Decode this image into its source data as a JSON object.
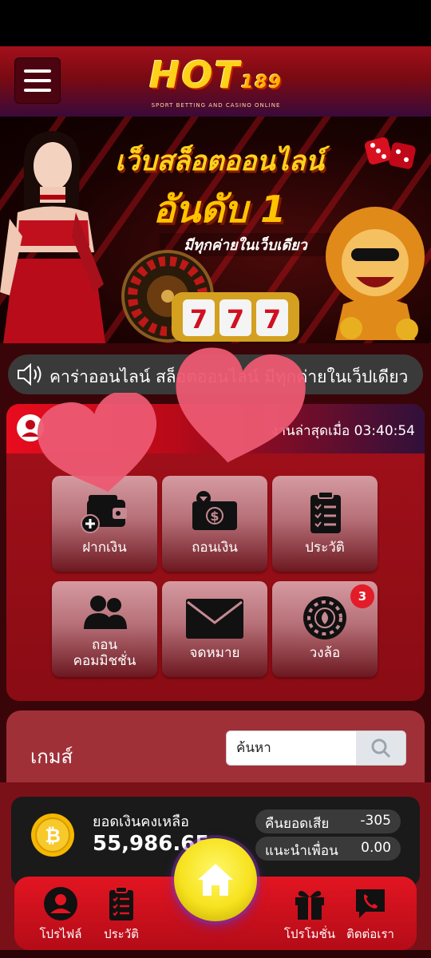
{
  "header": {
    "logo_text": "HOT",
    "logo_number": "189",
    "logo_tagline": "SPORT BETTING AND CASINO ONLINE"
  },
  "banner": {
    "title_line1": "เว็บสล็อตออนไลน์",
    "title_line2": "อันดับ 1",
    "subtitle": "มีทุกค่ายในเว็บเดียว"
  },
  "ticker": {
    "text": "คาร่าออนไลน์ สล็อตออนไลน์ มีทุกค่ายในเว็ปเดียว"
  },
  "user": {
    "last_login_label": "ออนไลน์ล่าสุดเมื่อ",
    "last_login_visible": "งานล่าสุดเมื่อ",
    "last_login_time": "03:40:54"
  },
  "tiles": [
    {
      "label": "ฝากเงิน",
      "icon": "wallet-plus-icon"
    },
    {
      "label": "ถอนเงิน",
      "icon": "cash-withdraw-icon"
    },
    {
      "label": "ประวัติ",
      "icon": "clipboard-list-icon"
    },
    {
      "label_line1": "ถอน",
      "label_line2": "คอมมิชชั่น",
      "icon": "users-icon"
    },
    {
      "label": "จดหมาย",
      "icon": "envelope-icon"
    },
    {
      "label": "วงล้อ",
      "icon": "wheel-icon",
      "badge": "3"
    }
  ],
  "games": {
    "title": "เกมส์",
    "search_placeholder": "ค้นหา"
  },
  "balance": {
    "label": "ยอดเงินคงเหลือ",
    "value": "55,986.65",
    "cashback_label": "คืนยอดเสีย",
    "cashback_value": "-305",
    "referral_label": "แนะนำเพื่อน",
    "referral_value": "0.00"
  },
  "nav": {
    "profile": "โปรไฟล์",
    "history": "ประวัติ",
    "promotion": "โปรโมชั่น",
    "contact": "ติดต่อเรา"
  },
  "colors": {
    "primary_red": "#e21521",
    "panel_red": "#a2101a",
    "gold": "#ffd21a",
    "home_yellow": "#f7e21e"
  }
}
